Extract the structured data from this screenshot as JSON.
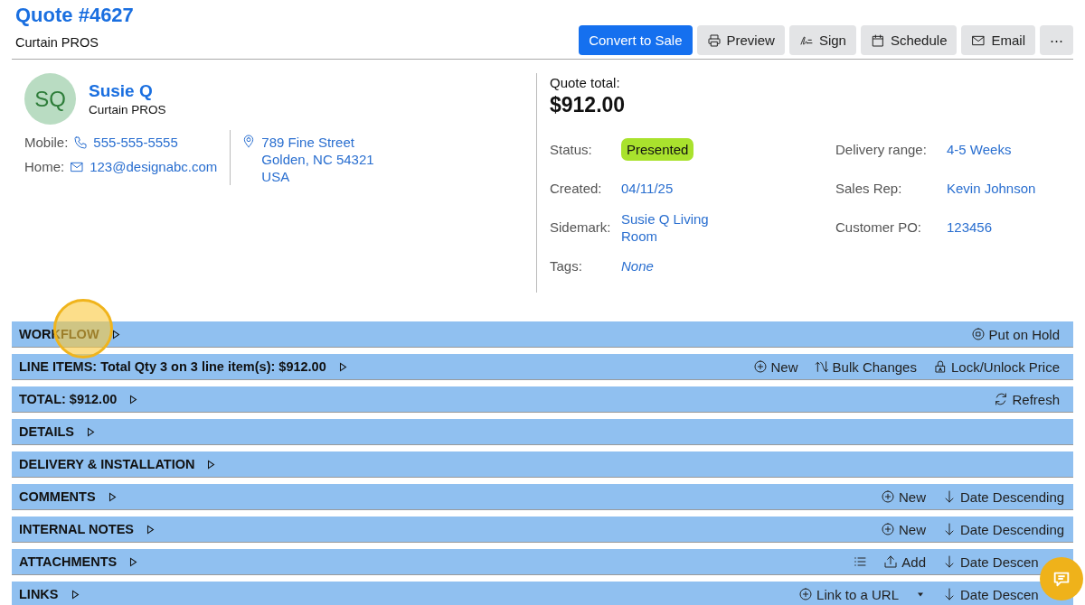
{
  "header": {
    "title": "Quote #4627",
    "subtitle": "Curtain PROS"
  },
  "actions": [
    {
      "kind": "primary",
      "label": "Convert to Sale"
    },
    {
      "kind": "printer",
      "label": "Preview"
    },
    {
      "kind": "signature",
      "label": "Sign"
    },
    {
      "kind": "calendar",
      "label": "Schedule"
    },
    {
      "kind": "envelope",
      "label": "Email"
    },
    {
      "kind": "more",
      "label": "⋯"
    }
  ],
  "customer": {
    "initials": "SQ",
    "name": "Susie Q",
    "company": "Curtain PROS",
    "contacts": [
      {
        "label": "Mobile:",
        "kind": "phone",
        "value": "555-555-5555"
      },
      {
        "label": "Home:",
        "kind": "envelope",
        "value": "123@designabc.com"
      }
    ],
    "address": [
      "789 Fine Street",
      "Golden, NC 54321",
      "USA"
    ]
  },
  "quote": {
    "total_label": "Quote total:",
    "total": "$912.00",
    "fields": [
      {
        "label": "Status:",
        "value": "Presented",
        "kind": "badge"
      },
      {
        "label": "Delivery range:",
        "value": "4-5 Weeks",
        "kind": "link"
      },
      {
        "label": "Created:",
        "value": "04/11/25",
        "kind": "link"
      },
      {
        "label": "Sales Rep:",
        "value": "Kevin Johnson",
        "kind": "link"
      },
      {
        "label": "Sidemark:",
        "value": "Susie Q Living Room",
        "kind": "link"
      },
      {
        "label": "Customer PO:",
        "value": "123456",
        "kind": "link"
      },
      {
        "label": "Tags:",
        "value": "None",
        "kind": "empty"
      }
    ]
  },
  "sections": [
    {
      "title": "WORKFLOW",
      "actions": [
        {
          "kind": "pause",
          "label": "Put on Hold"
        }
      ]
    },
    {
      "title": "LINE ITEMS: Total Qty 3 on 3 line item(s): $912.00",
      "actions": [
        {
          "kind": "plus",
          "label": "New"
        },
        {
          "kind": "bulk",
          "label": "Bulk Changes"
        },
        {
          "kind": "lock",
          "label": "Lock/Unlock Price"
        }
      ]
    },
    {
      "title": "TOTAL: $912.00",
      "actions": [
        {
          "kind": "refresh",
          "label": "Refresh"
        }
      ]
    },
    {
      "title": "DETAILS"
    },
    {
      "title": "DELIVERY & INSTALLATION"
    },
    {
      "title": "COMMENTS",
      "actions": [
        {
          "kind": "plus",
          "label": "New"
        },
        {
          "kind": "sort",
          "label": "Date Descending"
        }
      ]
    },
    {
      "title": "INTERNAL NOTES",
      "actions": [
        {
          "kind": "plus",
          "label": "New"
        },
        {
          "kind": "sort",
          "label": "Date Descending"
        }
      ]
    },
    {
      "title": "ATTACHMENTS",
      "actions": [
        {
          "kind": "list"
        },
        {
          "kind": "upload",
          "label": "Add"
        },
        {
          "kind": "sort",
          "label": "Date Descen"
        }
      ]
    },
    {
      "title": "LINKS",
      "actions": [
        {
          "kind": "plus",
          "label": "Link to a URL"
        },
        {
          "kind": "caret"
        },
        {
          "kind": "sort",
          "label": "Date Descen"
        }
      ]
    }
  ]
}
